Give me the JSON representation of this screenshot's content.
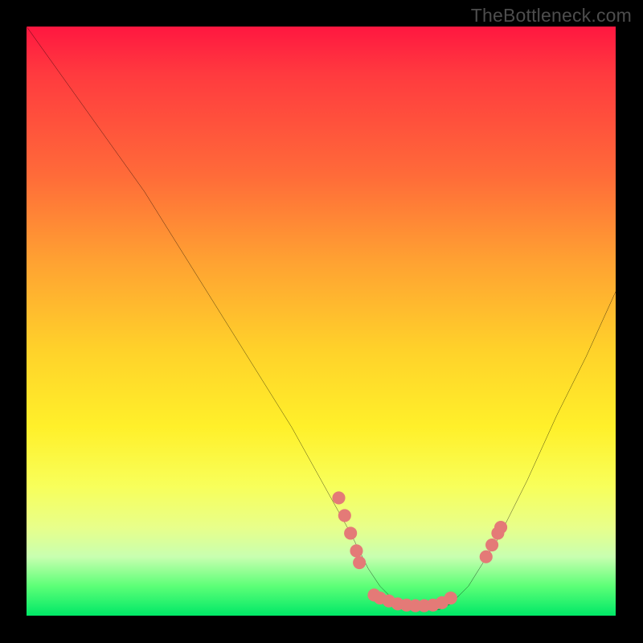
{
  "watermark": "TheBottleneck.com",
  "chart_data": {
    "type": "line",
    "title": "",
    "xlabel": "",
    "ylabel": "",
    "xlim": [
      0,
      100
    ],
    "ylim": [
      0,
      100
    ],
    "series": [
      {
        "name": "curve",
        "x": [
          0,
          5,
          10,
          15,
          20,
          25,
          30,
          35,
          40,
          45,
          50,
          55,
          58,
          60,
          62,
          65,
          68,
          70,
          72,
          75,
          80,
          85,
          90,
          95,
          100
        ],
        "y": [
          100,
          93,
          86,
          79,
          72,
          64,
          56,
          48,
          40,
          32,
          23,
          14,
          8,
          5,
          3,
          1,
          1,
          1,
          2,
          5,
          13,
          23,
          34,
          44,
          55
        ]
      }
    ],
    "dots": {
      "name": "markers",
      "color": "#e47a77",
      "points": [
        {
          "x": 53,
          "y": 20
        },
        {
          "x": 54,
          "y": 17
        },
        {
          "x": 55,
          "y": 14
        },
        {
          "x": 56,
          "y": 11
        },
        {
          "x": 56.5,
          "y": 9
        },
        {
          "x": 59,
          "y": 3.5
        },
        {
          "x": 60,
          "y": 3
        },
        {
          "x": 61.5,
          "y": 2.5
        },
        {
          "x": 63,
          "y": 2
        },
        {
          "x": 64.5,
          "y": 1.8
        },
        {
          "x": 66,
          "y": 1.7
        },
        {
          "x": 67.5,
          "y": 1.7
        },
        {
          "x": 69,
          "y": 1.8
        },
        {
          "x": 70.5,
          "y": 2.2
        },
        {
          "x": 72,
          "y": 3
        },
        {
          "x": 78,
          "y": 10
        },
        {
          "x": 79,
          "y": 12
        },
        {
          "x": 80,
          "y": 14
        },
        {
          "x": 80.5,
          "y": 15
        }
      ]
    },
    "colors": {
      "curve_stroke": "#000000",
      "dot_fill": "#e47a77",
      "background_top": "#ff1740",
      "background_bottom": "#00e867",
      "frame": "#000000"
    }
  }
}
